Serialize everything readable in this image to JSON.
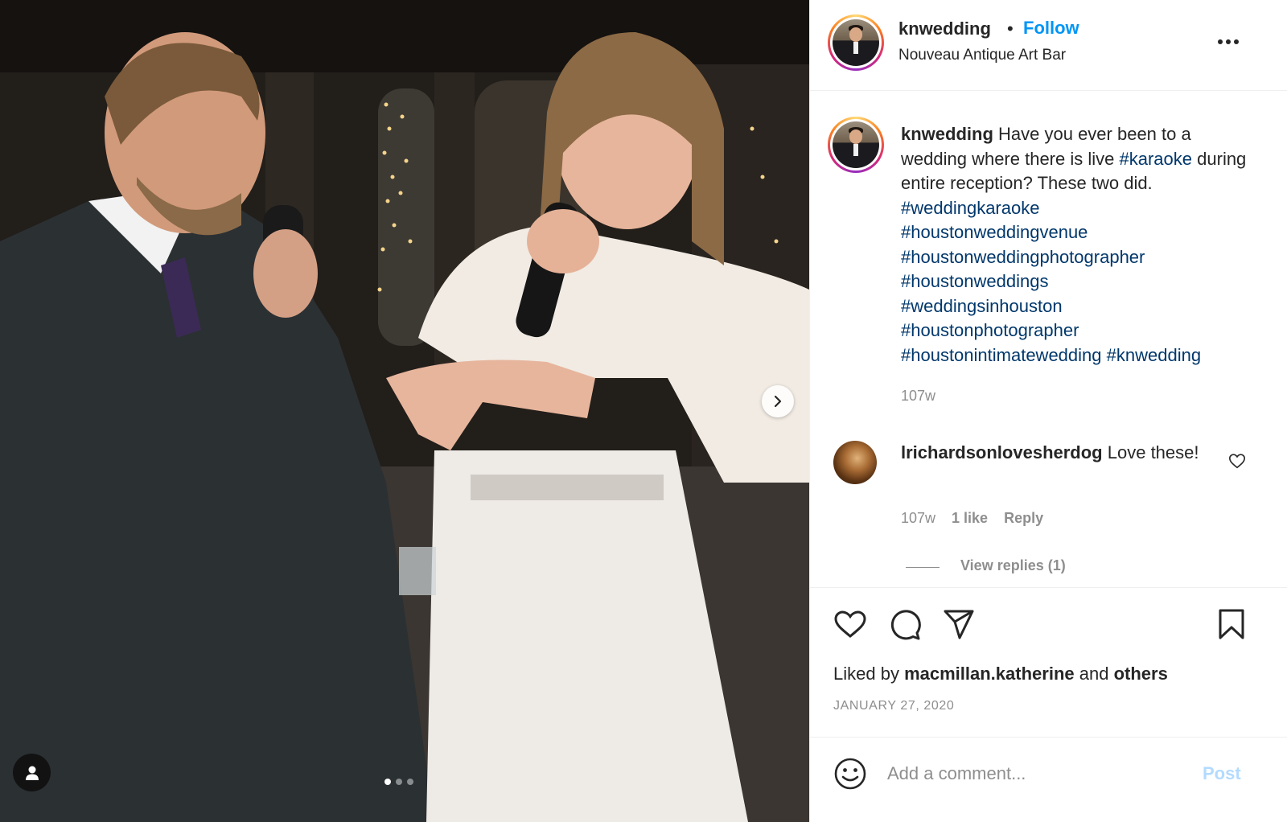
{
  "post": {
    "username": "knwedding",
    "separator": "•",
    "follow_label": "Follow",
    "location": "Nouveau Antique Art Bar",
    "more_icon": "more-options-icon"
  },
  "caption": {
    "username": "knwedding",
    "text_1": "Have you ever been to a wedding where there is live",
    "tag_1": "#karaoke",
    "text_2": "during entire reception? These two did.",
    "hashtags": [
      "#weddingkaraoke",
      "#houstonweddingvenue",
      "#houstonweddingphotographer",
      "#houstonweddings",
      "#weddingsinhouston",
      "#houstonphotographer",
      "#houstonintimatewedding",
      "#knwedding"
    ],
    "time": "107w"
  },
  "comment": {
    "username": "lrichardsonlovesherdog",
    "text": "Love these!",
    "time": "107w",
    "likes": "1 like",
    "reply_label": "Reply",
    "view_replies": "View replies (1)"
  },
  "actions": {
    "icons": [
      "heart-icon",
      "comment-icon",
      "share-icon",
      "bookmark-icon"
    ],
    "liked_prefix": "Liked by",
    "liked_user": "macmillan.katherine",
    "liked_and": "and",
    "liked_others": "others",
    "date": "JANUARY 27, 2020"
  },
  "add_comment": {
    "placeholder": "Add a comment...",
    "post_label": "Post"
  },
  "carousel": {
    "slide_count": 3,
    "active_index": 0
  },
  "colors": {
    "link_blue": "#0095f6",
    "hashtag_blue": "#00376b",
    "muted_gray": "#8e8e8e",
    "post_disabled": "#b3dbff"
  }
}
